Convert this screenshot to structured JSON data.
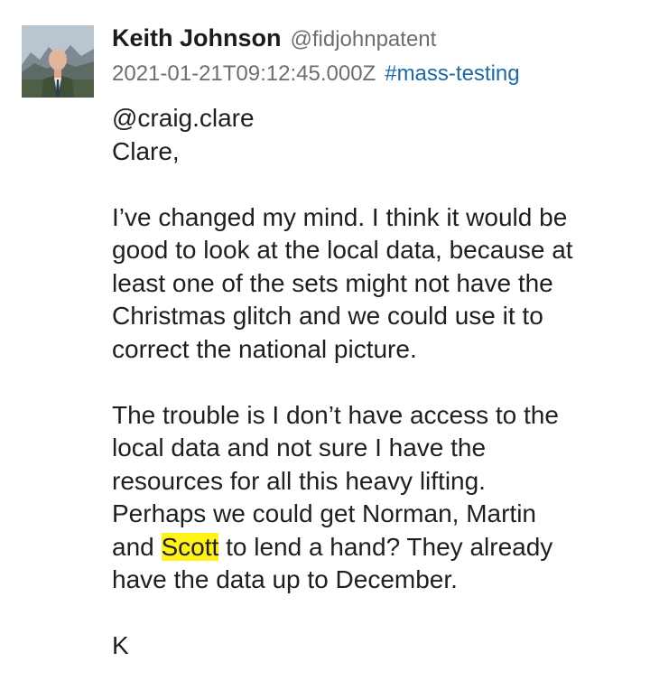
{
  "post": {
    "author": {
      "display_name": "Keith Johnson",
      "handle": "@fidjohnpatent",
      "avatar_icon": "user-avatar-photo"
    },
    "timestamp": "2021-01-21T09:12:45.000Z",
    "hashtag": "#mass-testing",
    "colors": {
      "hashtag": "#1b6aa5",
      "highlight": "#fff21a",
      "meta": "#6e6e6e"
    },
    "body": {
      "mention": "@craig.clare",
      "greeting": "Clare,",
      "p1": [
        "I’ve changed my mind. I think it would be",
        "good to look at the local data, because at",
        "least one of the sets might not have the",
        "Christmas glitch and we could use it to",
        "correct the national picture."
      ],
      "p2": [
        "The trouble is I don’t have access to the",
        "local data and not sure I have the",
        "resources for all this heavy lifting.",
        "Perhaps we could get Norman, Martin"
      ],
      "p2_line5": {
        "before": "and ",
        "highlighted": "Scott",
        "after": " to lend a hand? They already"
      },
      "p2_line6": "have the data up to December.",
      "signoff": "K"
    }
  }
}
